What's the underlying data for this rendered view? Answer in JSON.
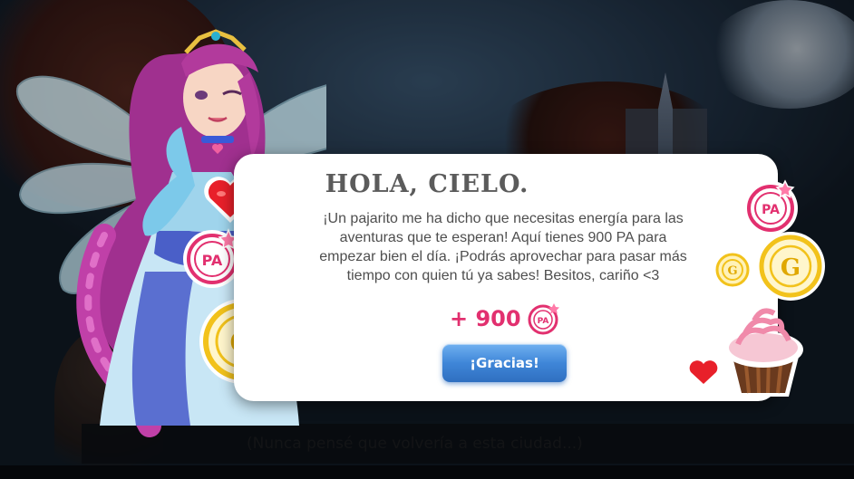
{
  "scene": {
    "dialogue_text": "(Nunca pensé que volvería a esta ciudad...)"
  },
  "popup": {
    "title": "HOLA, CIELO.",
    "body": "¡Un pajarito me ha dicho que necesitas energía para las aventuras que te esperan! Aquí tienes 900 PA para empezar bien el día. ¡Podrás aprovechar para pasar más tiempo con quien tú ya sabes! Besitos, cariño <3",
    "reward_amount": "+ 900",
    "reward_icon": "pa-token-icon",
    "reward_icon_text": "PA",
    "button_label": "¡Gracias!"
  },
  "decorations": {
    "pa_coin_text": "PA",
    "gold_coin_text": "G",
    "heart_color": "#e8202a",
    "pink_color": "#e2306f",
    "gold_color": "#f2c21b"
  },
  "colors": {
    "button_blue": "#3f86d8",
    "title_gray": "#5b5b5b",
    "accent_pink": "#e2306f"
  }
}
